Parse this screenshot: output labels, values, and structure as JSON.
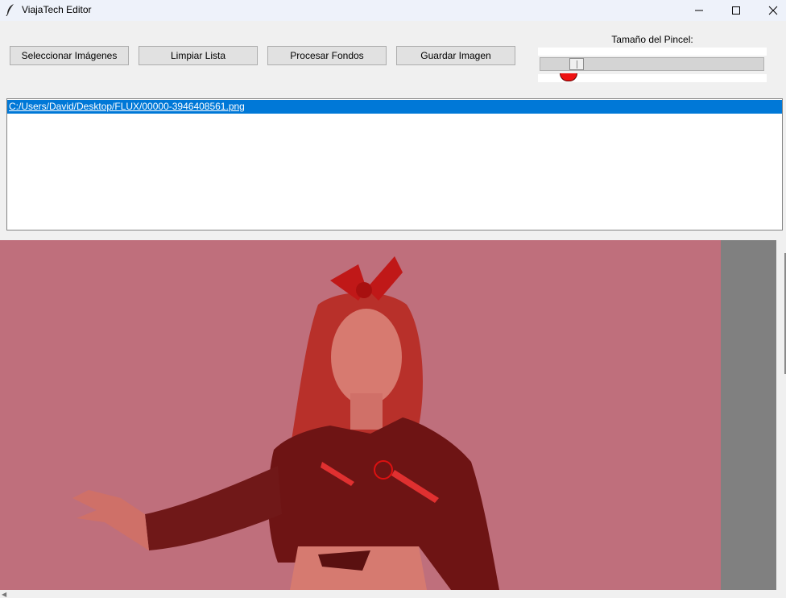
{
  "window": {
    "title": "ViajaTech Editor",
    "app_icon": "feather-icon",
    "controls": [
      "minimize-icon",
      "maximize-icon",
      "close-icon"
    ]
  },
  "toolbar": {
    "select_images": "Seleccionar Imágenes",
    "clear_list": "Limpiar Lista",
    "process_backgrounds": "Procesar Fondos",
    "save_image": "Guardar Imagen"
  },
  "brush": {
    "label": "Tamaño del Pincel:",
    "value_fraction": 0.14,
    "preview_color": "#ee1111"
  },
  "file_list": {
    "items": [
      "C:/Users/David/Desktop/FLUX/00000-3946408561.png"
    ],
    "selected_index": 0,
    "selection_color": "#0078d7"
  },
  "canvas": {
    "overlay_color": "#c0606e",
    "background_color": "#808080",
    "cursor_color": "#dd1111"
  }
}
